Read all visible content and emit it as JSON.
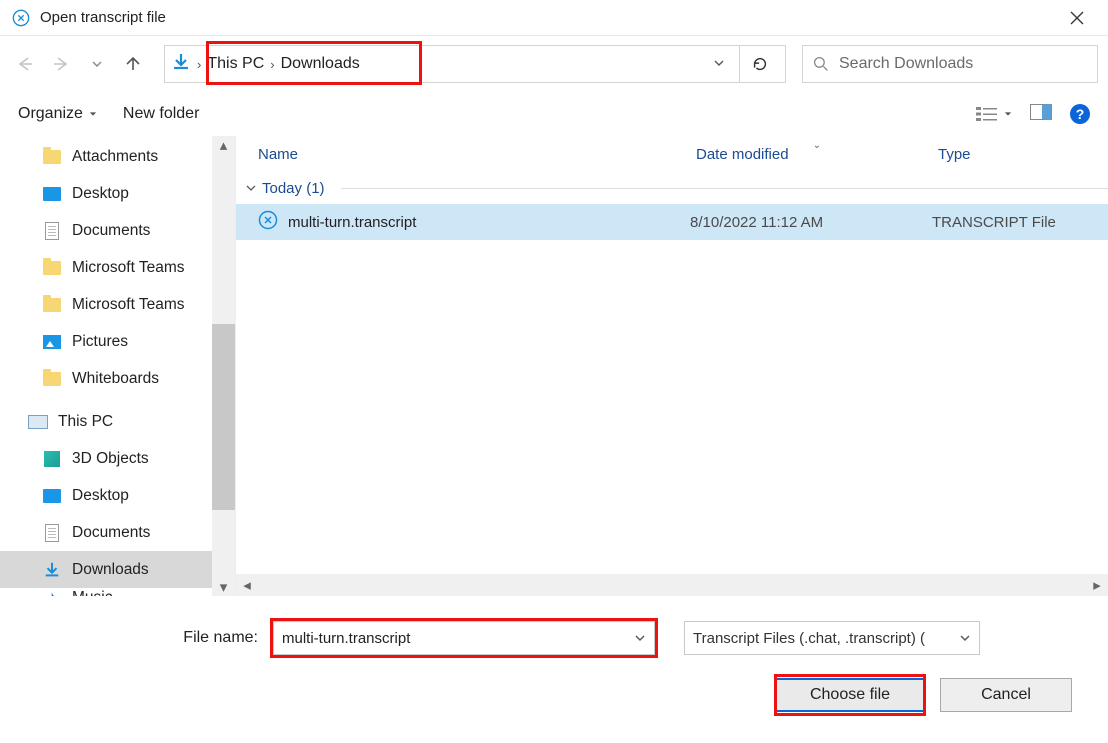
{
  "window": {
    "title": "Open transcript file",
    "close_tooltip": "Close"
  },
  "breadcrumb": {
    "segments": [
      "This PC",
      "Downloads"
    ]
  },
  "search": {
    "placeholder": "Search Downloads"
  },
  "toolbar": {
    "organize": "Organize",
    "new_folder": "New folder"
  },
  "tree": {
    "items": [
      {
        "label": "Attachments",
        "icon": "folder",
        "level": 1
      },
      {
        "label": "Desktop",
        "icon": "desktop",
        "level": 1
      },
      {
        "label": "Documents",
        "icon": "doc",
        "level": 1
      },
      {
        "label": "Microsoft Teams",
        "icon": "folder",
        "level": 1
      },
      {
        "label": "Microsoft Teams",
        "icon": "folder",
        "level": 1
      },
      {
        "label": "Pictures",
        "icon": "pictures",
        "level": 1
      },
      {
        "label": "Whiteboards",
        "icon": "folder",
        "level": 1
      },
      {
        "label": "This PC",
        "icon": "pc",
        "level": 0
      },
      {
        "label": "3D Objects",
        "icon": "cube",
        "level": 1
      },
      {
        "label": "Desktop",
        "icon": "desktop",
        "level": 1
      },
      {
        "label": "Documents",
        "icon": "doc",
        "level": 1
      },
      {
        "label": "Downloads",
        "icon": "download",
        "level": 1,
        "selected": true
      },
      {
        "label": "Music",
        "icon": "music",
        "level": 1,
        "clipped": true
      }
    ]
  },
  "columns": {
    "name": "Name",
    "date": "Date modified",
    "type": "Type"
  },
  "group_header": "Today (1)",
  "files": [
    {
      "name": "multi-turn.transcript",
      "date": "8/10/2022 11:12 AM",
      "type": "TRANSCRIPT File",
      "selected": true
    }
  ],
  "filebar": {
    "label": "File name:",
    "value": "multi-turn.transcript",
    "filter": "Transcript Files (.chat, .transcript) ("
  },
  "buttons": {
    "choose": "Choose file",
    "cancel": "Cancel"
  }
}
